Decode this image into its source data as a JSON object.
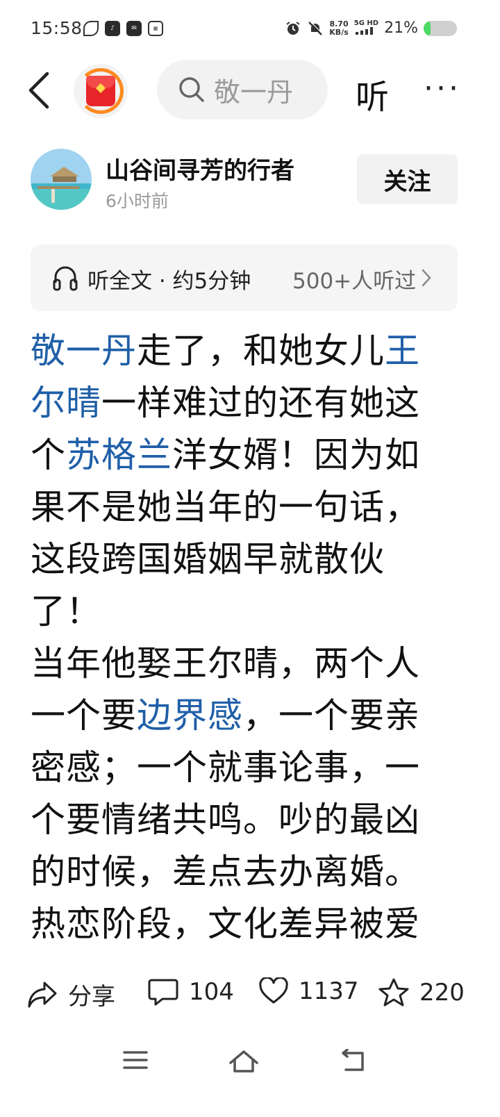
{
  "status_bar": {
    "time": "15:58",
    "net_speed_value": "8.70",
    "net_speed_unit": "KB/s",
    "signal_label": "5G HD",
    "battery_percent_label": "21%",
    "battery_level": 0.21,
    "app_icons": [
      "leaf-app-icon",
      "tiktok-icon",
      "mail-app-icon",
      "toutiao-icon"
    ]
  },
  "nav": {
    "search_text": "敬一丹",
    "listen_label": "听",
    "more_label": "···"
  },
  "author": {
    "name": "山谷间寻芳的行者",
    "time": "6小时前",
    "follow_label": "关注"
  },
  "listen_card": {
    "label": "听全文 · 约5分钟",
    "listeners": "500+人听过"
  },
  "article": {
    "paragraphs": [
      [
        {
          "text": "敬一丹",
          "link": true
        },
        {
          "text": "走了，和她女儿",
          "link": false
        },
        {
          "text": "王尔晴",
          "link": true
        },
        {
          "text": "一样难过的还有她这个",
          "link": false
        },
        {
          "text": "苏格兰",
          "link": true
        },
        {
          "text": "洋女婿！因为如果不是她当年的一句话，这段跨国婚姻早就散伙了！",
          "link": false
        }
      ],
      [
        {
          "text": "当年他娶王尔晴，两个人一个要",
          "link": false
        },
        {
          "text": "边界感",
          "link": true
        },
        {
          "text": "，一个要亲密感；一个就事论事，一个要情绪共鸣。吵的最凶的时候，差点去办离婚。热恋阶段，文化差异被爱",
          "link": false
        }
      ]
    ]
  },
  "actions": {
    "share_label": "分享",
    "comment_count": "104",
    "like_count": "1137",
    "favorite_count": "220"
  },
  "colors": {
    "link": "#1f5fa8",
    "accent_orange": "#ff8a1f",
    "red_packet": "#e8242b",
    "battery_green": "#4cd964"
  }
}
